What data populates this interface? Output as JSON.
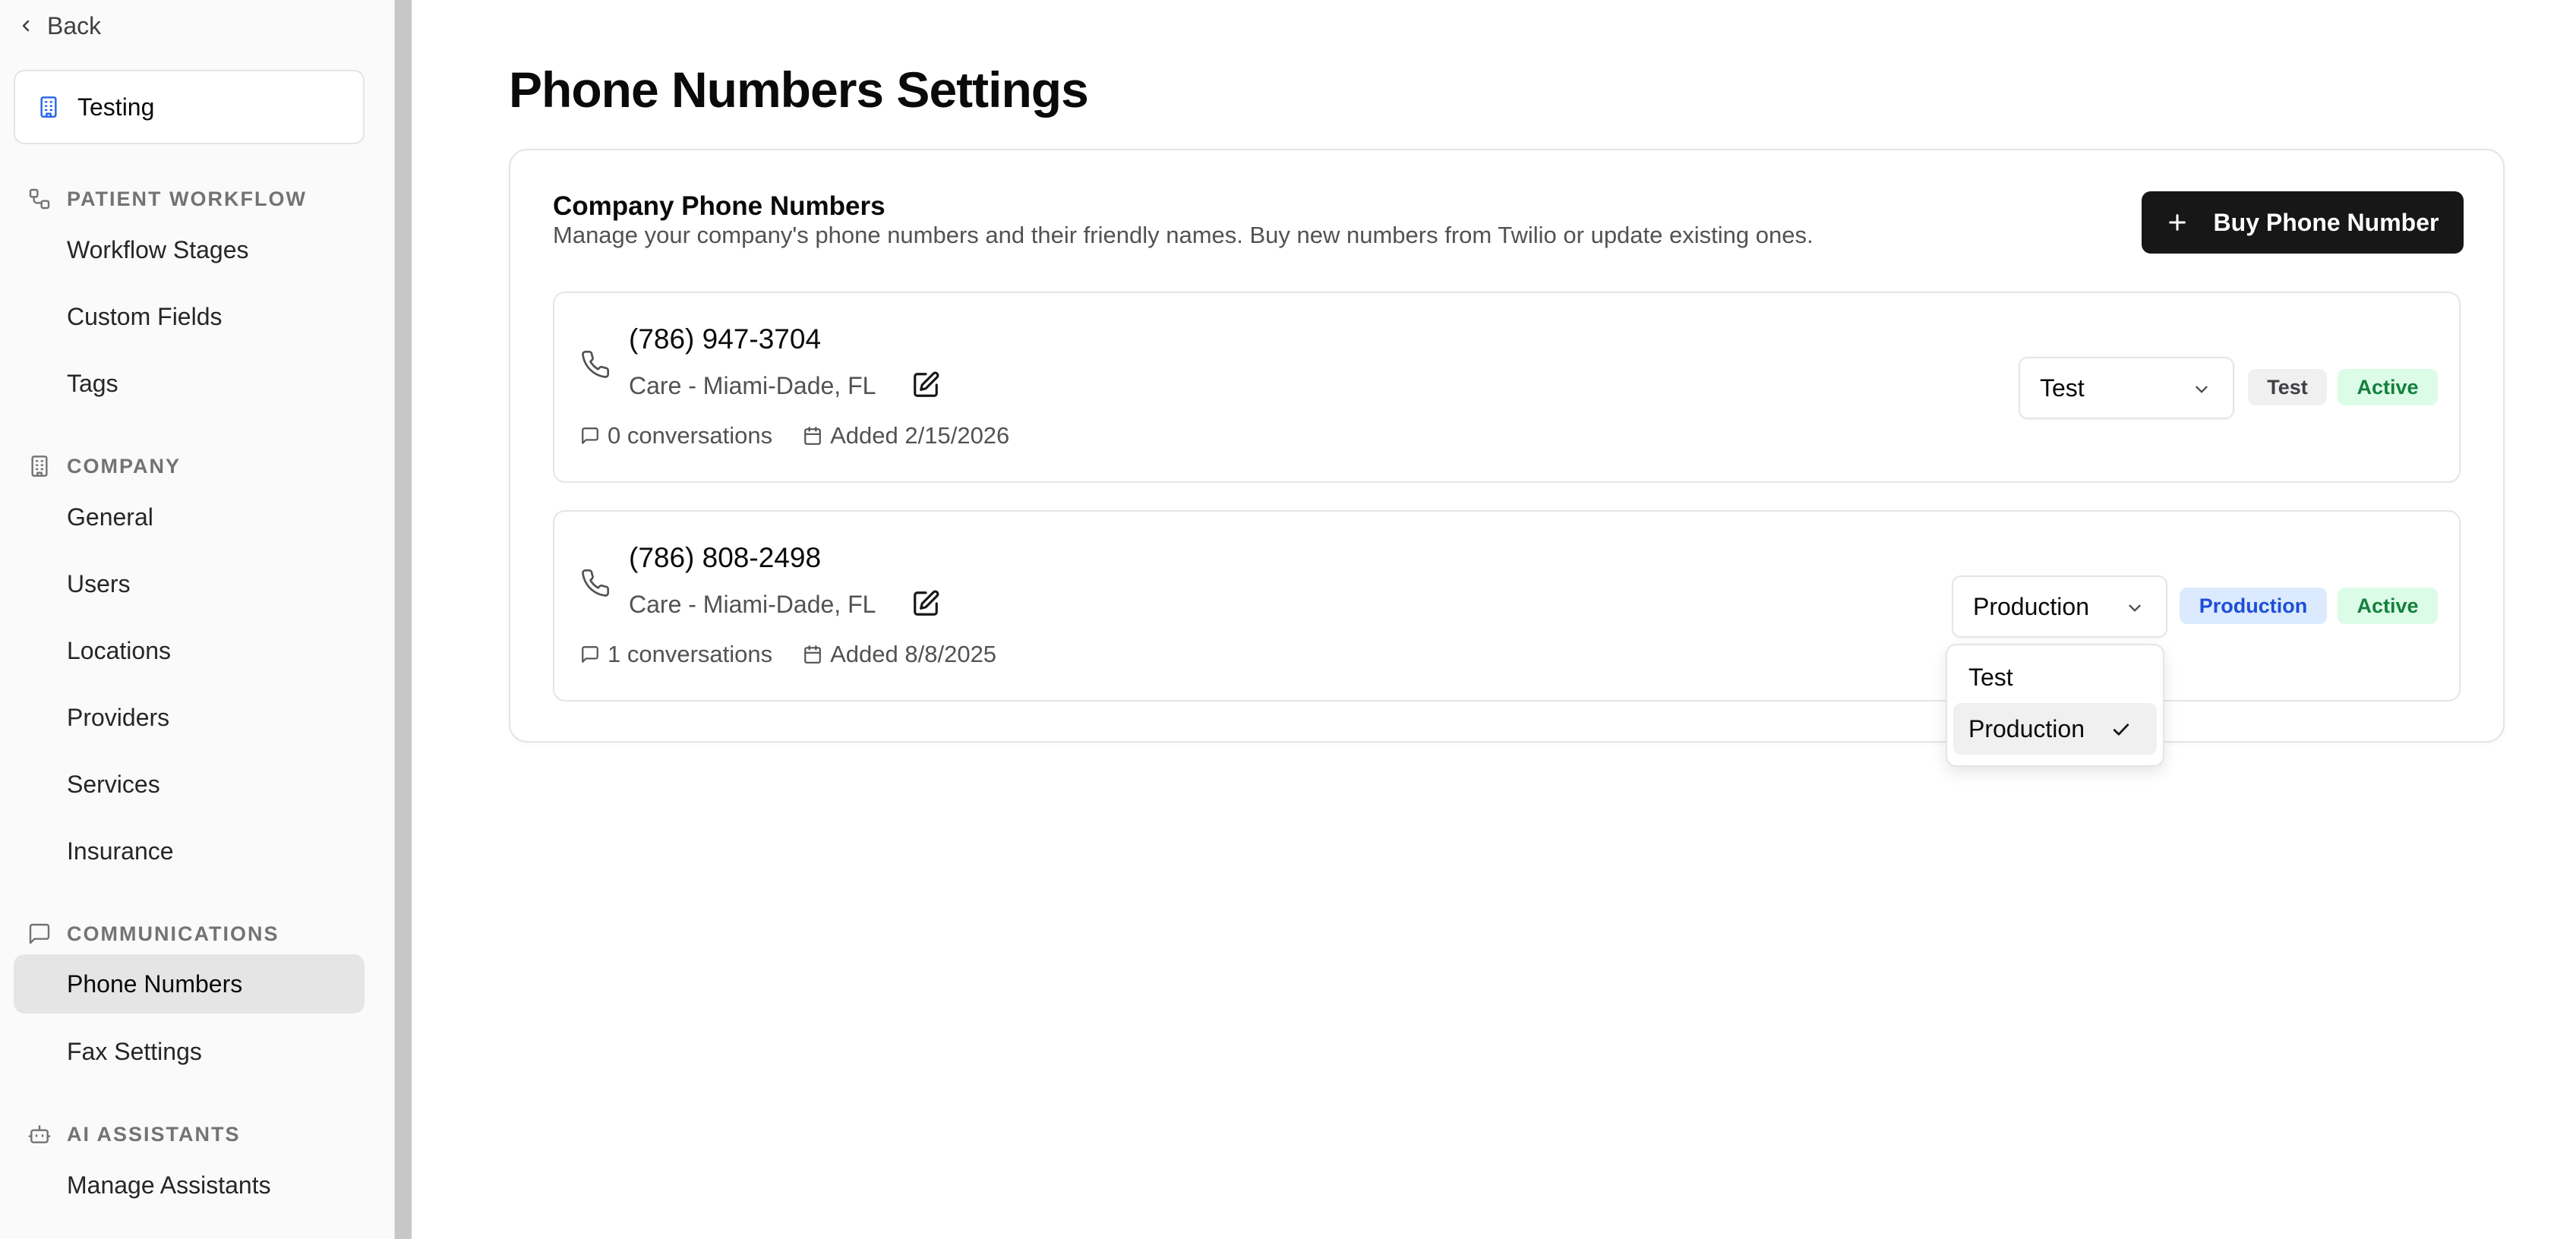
{
  "sidebar": {
    "back_label": "Back",
    "org_name": "Testing",
    "sections": [
      {
        "title": "PATIENT WORKFLOW",
        "icon": "workflow-icon",
        "items": [
          "Workflow Stages",
          "Custom Fields",
          "Tags"
        ]
      },
      {
        "title": "COMPANY",
        "icon": "building-icon",
        "items": [
          "General",
          "Users",
          "Locations",
          "Providers",
          "Services",
          "Insurance"
        ]
      },
      {
        "title": "COMMUNICATIONS",
        "icon": "message-icon",
        "items": [
          "Phone Numbers",
          "Fax Settings"
        ]
      },
      {
        "title": "AI ASSISTANTS",
        "icon": "bot-icon",
        "items": [
          "Manage Assistants"
        ]
      }
    ],
    "active_item": "Phone Numbers"
  },
  "page": {
    "title": "Phone Numbers Settings"
  },
  "card": {
    "title": "Company Phone Numbers",
    "description": "Manage your company's phone numbers and their friendly names. Buy new numbers from Twilio or update existing ones.",
    "buy_button_label": "Buy Phone Number"
  },
  "phone_numbers": [
    {
      "number": "(786) 947-3704",
      "friendly_name": "Care - Miami-Dade, FL",
      "conversations": "0 conversations",
      "added": "Added 2/15/2026",
      "environment": "Test",
      "environment_badge": "Test",
      "status": "Active"
    },
    {
      "number": "(786) 808-2498",
      "friendly_name": "Care - Miami-Dade, FL",
      "conversations": "1 conversations",
      "added": "Added 8/8/2025",
      "environment": "Production",
      "environment_badge": "Production",
      "status": "Active"
    }
  ],
  "environment_dropdown": {
    "options": [
      "Test",
      "Production"
    ],
    "selected": "Production"
  },
  "colors": {
    "primary_button": "#171717",
    "active_badge_bg": "#dcfce7",
    "active_badge_text": "#15803d",
    "production_badge_bg": "#dbeafe",
    "production_badge_text": "#1d4ed8",
    "test_badge_bg": "#f0f0f0"
  }
}
